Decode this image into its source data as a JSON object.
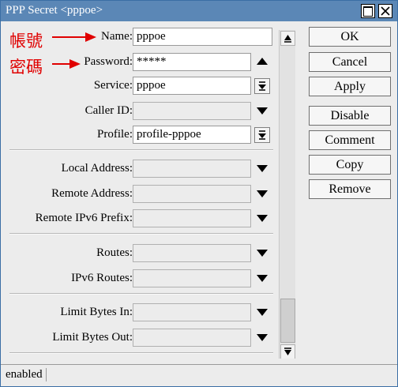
{
  "window": {
    "title": "PPP Secret <pppoe>"
  },
  "annotations": {
    "name_note": "帳號",
    "password_note": "密碼",
    "color": "#e00000"
  },
  "fields": {
    "name": {
      "label": "Name:",
      "value": "pppoe"
    },
    "password": {
      "label": "Password:",
      "value": "*****"
    },
    "service": {
      "label": "Service:",
      "value": "pppoe"
    },
    "caller_id": {
      "label": "Caller ID:",
      "value": ""
    },
    "profile": {
      "label": "Profile:",
      "value": "profile-pppoe"
    },
    "local_address": {
      "label": "Local Address:",
      "value": ""
    },
    "remote_address": {
      "label": "Remote Address:",
      "value": ""
    },
    "remote_ipv6_prefix": {
      "label": "Remote IPv6 Prefix:",
      "value": ""
    },
    "routes": {
      "label": "Routes:",
      "value": ""
    },
    "ipv6_routes": {
      "label": "IPv6 Routes:",
      "value": ""
    },
    "limit_bytes_in": {
      "label": "Limit Bytes In:",
      "value": ""
    },
    "limit_bytes_out": {
      "label": "Limit Bytes Out:",
      "value": ""
    }
  },
  "buttons": {
    "ok": "OK",
    "cancel": "Cancel",
    "apply": "Apply",
    "disable": "Disable",
    "comment": "Comment",
    "copy": "Copy",
    "remove": "Remove"
  },
  "status": {
    "text": "enabled"
  },
  "colors": {
    "titlebar": "#5b87b6",
    "panel": "#ececec"
  }
}
